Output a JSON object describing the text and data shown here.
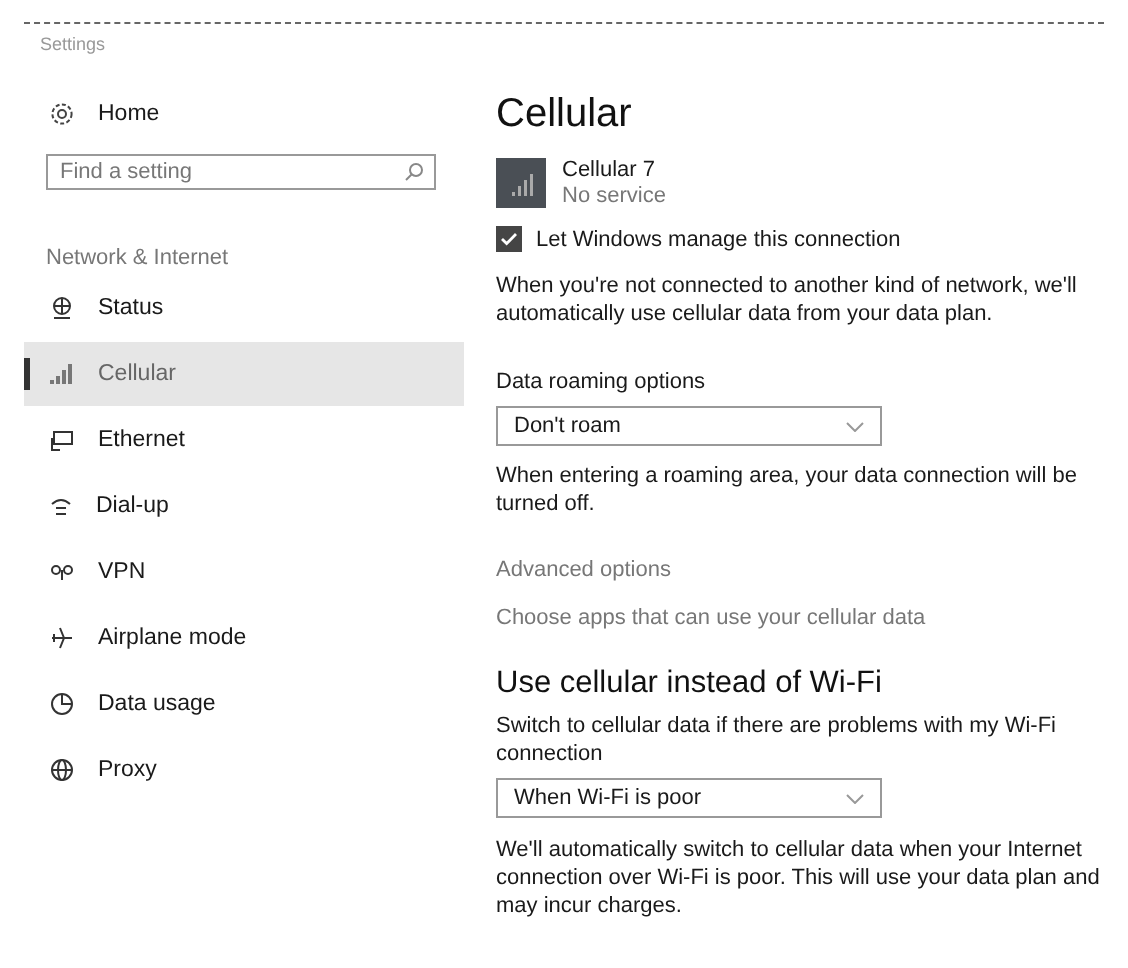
{
  "window": {
    "title": "Settings"
  },
  "sidebar": {
    "home": "Home",
    "search": {
      "placeholder": "Find a setting"
    },
    "section": "Network & Internet",
    "items": [
      {
        "label": "Status",
        "selected": false
      },
      {
        "label": "Cellular",
        "selected": true
      },
      {
        "label": "Ethernet",
        "selected": false
      },
      {
        "label": "Dial-up",
        "selected": false
      },
      {
        "label": "VPN",
        "selected": false
      },
      {
        "label": "Airplane mode",
        "selected": false
      },
      {
        "label": "Data usage",
        "selected": false
      },
      {
        "label": "Proxy",
        "selected": false
      }
    ]
  },
  "main": {
    "title": "Cellular",
    "connection": {
      "name": "Cellular 7",
      "status": "No service"
    },
    "manage": {
      "label": "Let Windows manage this connection",
      "checked": true
    },
    "manage_note": "When you're not connected to another kind of network, we'll automatically use cellular data from your data plan.",
    "roaming": {
      "label": "Data roaming options",
      "value": "Don't roam",
      "note": "When entering a roaming area, your data connection will be turned off."
    },
    "links": [
      "Advanced options",
      "Choose apps that can use your cellular data"
    ],
    "wifi_section": {
      "heading": "Use cellular instead of Wi-Fi",
      "label": "Switch to cellular data if there are problems with my Wi-Fi connection",
      "value": "When Wi-Fi is poor",
      "note": "We'll automatically switch to cellular data when your Internet connection over Wi-Fi is poor. This will use your data plan and may incur charges."
    }
  }
}
